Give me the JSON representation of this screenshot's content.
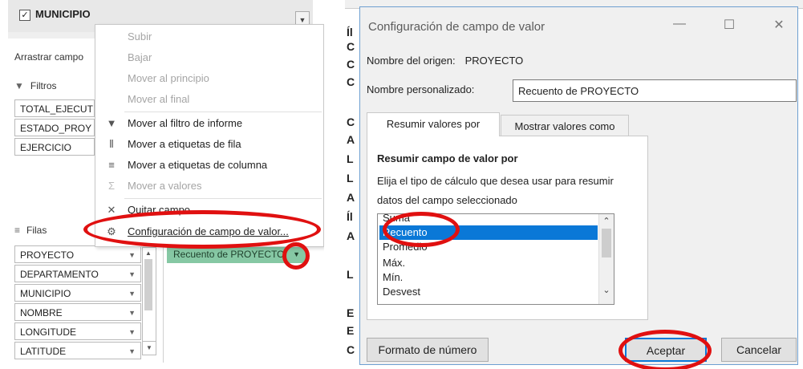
{
  "pivot_pane": {
    "field_top": "MUNICIPIO",
    "drag_label": "Arrastrar campo",
    "filters_title": "Filtros",
    "filters": [
      "TOTAL_EJECUT",
      "ESTADO_PROY",
      "EJERCICIO"
    ],
    "rows_title": "Filas",
    "rows": [
      "PROYECTO",
      "DEPARTAMENTO",
      "MUNICIPIO",
      "NOMBRE",
      "LONGITUDE",
      "LATITUDE"
    ],
    "value_field": "Recuento de PROYECTO"
  },
  "context_menu": {
    "items": [
      {
        "label": "Subir",
        "enabled": false,
        "icon": ""
      },
      {
        "label": "Bajar",
        "enabled": false,
        "icon": ""
      },
      {
        "label": "Mover al principio",
        "enabled": false,
        "icon": ""
      },
      {
        "label": "Mover al final",
        "enabled": false,
        "icon": ""
      },
      {
        "label": "Mover al filtro de informe",
        "enabled": true,
        "icon": "filter-icon"
      },
      {
        "label": "Mover a etiquetas de fila",
        "enabled": true,
        "icon": "rows-icon"
      },
      {
        "label": "Mover a etiquetas de columna",
        "enabled": true,
        "icon": "columns-icon"
      },
      {
        "label": "Mover a valores",
        "enabled": false,
        "icon": "sigma-icon"
      },
      {
        "label": "Quitar campo",
        "enabled": true,
        "icon": "remove-icon"
      },
      {
        "label": "Configuración de campo de valor...",
        "enabled": true,
        "icon": "field-settings-icon"
      }
    ]
  },
  "sheet_letters": [
    "Íl",
    "C",
    "C",
    "C",
    "A",
    "L",
    "L",
    "A",
    "Íl",
    "A",
    "L",
    "E",
    "E",
    "C"
  ],
  "dialog": {
    "title": "Configuración de campo de valor",
    "source_label": "Nombre del origen:",
    "source_value": "PROYECTO",
    "custom_name_label": "Nombre personalizado:",
    "custom_name_value": "Recuento de PROYECTO",
    "tabs": [
      "Resumir valores por",
      "Mostrar valores como"
    ],
    "panel_heading": "Resumir campo de valor por",
    "panel_desc_1": "Elija el tipo de cálculo que desea usar para resumir",
    "panel_desc_2": "datos del campo seleccionado",
    "functions": [
      "Suma",
      "Recuento",
      "Promedio",
      "Máx.",
      "Mín.",
      "Desvest"
    ],
    "selected_function": "Recuento",
    "buttons": {
      "format": "Formato de número",
      "ok": "Aceptar",
      "cancel": "Cancelar"
    }
  },
  "colors": {
    "annotation": "#e01010",
    "selection": "#0a78d7",
    "value_field_bg": "#86c8a4"
  }
}
